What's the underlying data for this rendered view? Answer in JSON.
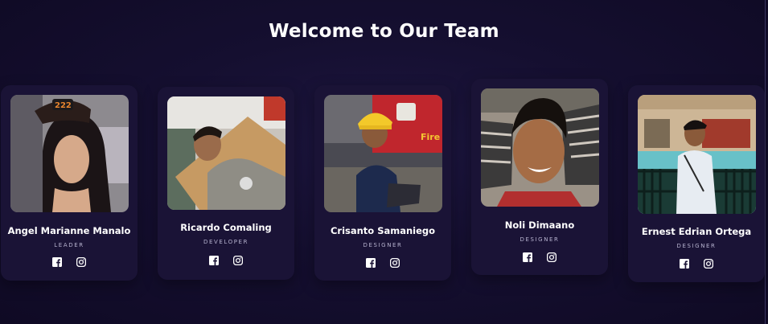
{
  "page": {
    "title": "Welcome to Our Team"
  },
  "members": [
    {
      "name": "Angel Marianne Manalo",
      "role": "LEADER",
      "icons": [
        "facebook-icon",
        "instagram-icon"
      ]
    },
    {
      "name": "Ricardo Comaling",
      "role": "DEVELOPER",
      "icons": [
        "facebook-icon",
        "instagram-icon"
      ]
    },
    {
      "name": "Crisanto Samaniego",
      "role": "DESIGNER",
      "icons": [
        "facebook-icon",
        "instagram-icon"
      ]
    },
    {
      "name": "Noli Dimaano",
      "role": "DESIGNER",
      "icons": [
        "facebook-icon",
        "instagram-icon"
      ]
    },
    {
      "name": "Ernest Edrian Ortega",
      "role": "DESIGNER",
      "icons": [
        "facebook-icon",
        "instagram-icon"
      ]
    }
  ],
  "colors": {
    "background": "#150f30",
    "card": "#1a1336",
    "role_text": "#b7b3cf"
  }
}
